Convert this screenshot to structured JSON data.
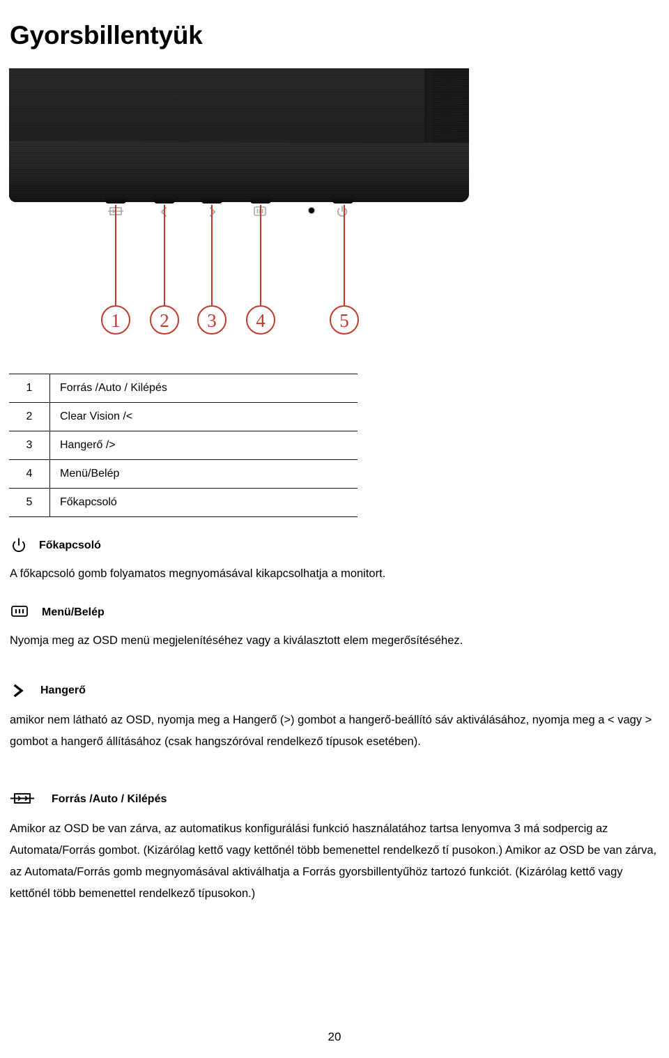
{
  "document": {
    "title": "Gyorsbillentyük",
    "page_number": "20"
  },
  "figure": {
    "name": "monitor-front-panel-photo",
    "callouts": [
      "1",
      "2",
      "3",
      "4",
      "5"
    ],
    "button_glyphs": [
      "source-icon",
      "left-chevron-icon",
      "right-chevron-icon",
      "menu-icon",
      "power-icon"
    ],
    "accent_color": "#c0392b",
    "bezel_color": "#1c1b1b"
  },
  "table": {
    "rows": [
      {
        "num": "1",
        "label": "Forrás /Auto / Kilépés"
      },
      {
        "num": "2",
        "label": " Clear Vision /<"
      },
      {
        "num": "3",
        "label": "Hangerő />"
      },
      {
        "num": "4",
        "label": "Menü/Belép"
      },
      {
        "num": "5",
        "label": "Főkapcsoló"
      }
    ]
  },
  "sections": [
    {
      "icon": "power-icon",
      "title": "Főkapcsoló",
      "body": "A főkapcsoló gomb folyamatos megnyomásával kikapcsolhatja a monitort."
    },
    {
      "icon": "menu-icon",
      "title": "Menü/Belép",
      "body": "Nyomja meg az OSD menü megjelenítéséhez vagy a kiválasztott elem megerősítéséhez."
    },
    {
      "icon": "right-chevron-icon",
      "title": "Hangerő",
      "body": "amikor nem látható az OSD, nyomja meg a Hangerő (>) gombot a hangerő-beállító sáv aktiválásához, nyomja meg a < vagy > gombot a hangerő állításához (csak hangszóróval rendelkező típusok esetében)."
    },
    {
      "icon": "source-icon",
      "title": "Forrás /Auto / Kilépés",
      "body": "Amikor az OSD be van zárva, az automatikus konfigurálási funkció használatához tartsa lenyomva 3 má sodpercig az Automata/Forrás gombot. (Kizárólag kettő vagy kettőnél több bemenettel rendelkező tí pusokon.) Amikor az OSD be van zárva, az Automata/Forrás gomb megnyomásával aktiválhatja a Forrás gyorsbillentyűhöz tartozó funkciót. (Kizárólag kettő vagy kettőnél több bemenettel rendelkező típusokon.)"
    }
  ]
}
